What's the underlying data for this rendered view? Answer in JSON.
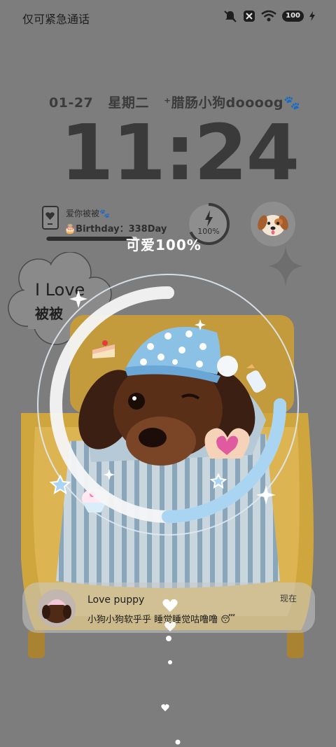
{
  "status_bar": {
    "carrier_text": "仅可紧急通话",
    "battery_label": "100",
    "icons": [
      "mute-bell-icon",
      "x-badge-icon",
      "wifi-icon",
      "battery-icon",
      "charging-bolt-icon"
    ]
  },
  "date": {
    "day": "01-27",
    "weekday": "星期二",
    "tagline": "⁺腊肠小狗doooog🐾"
  },
  "clock": {
    "time": "11:24"
  },
  "widget": {
    "line1": "爱你被被🐾",
    "line2": "🎂Birthday：338Day",
    "battery_percent": "100%",
    "cute_label": "可爱100%",
    "progress_fraction": 0.95
  },
  "cloud": {
    "line1": "I Love",
    "line2": "被被"
  },
  "notification": {
    "title": "Love puppy",
    "body": "小狗小狗软乎乎 睡觉睡觉咕噜噜 😴",
    "time": "现在"
  },
  "colors": {
    "background": "#7d7d7d",
    "text_dark": "#3a3a3a",
    "ring_white": "#ffffff",
    "ring_blue": "#a9d4f2",
    "bed_yellow": "#d9b24a",
    "bed_stripes": "#9fb9cc"
  }
}
